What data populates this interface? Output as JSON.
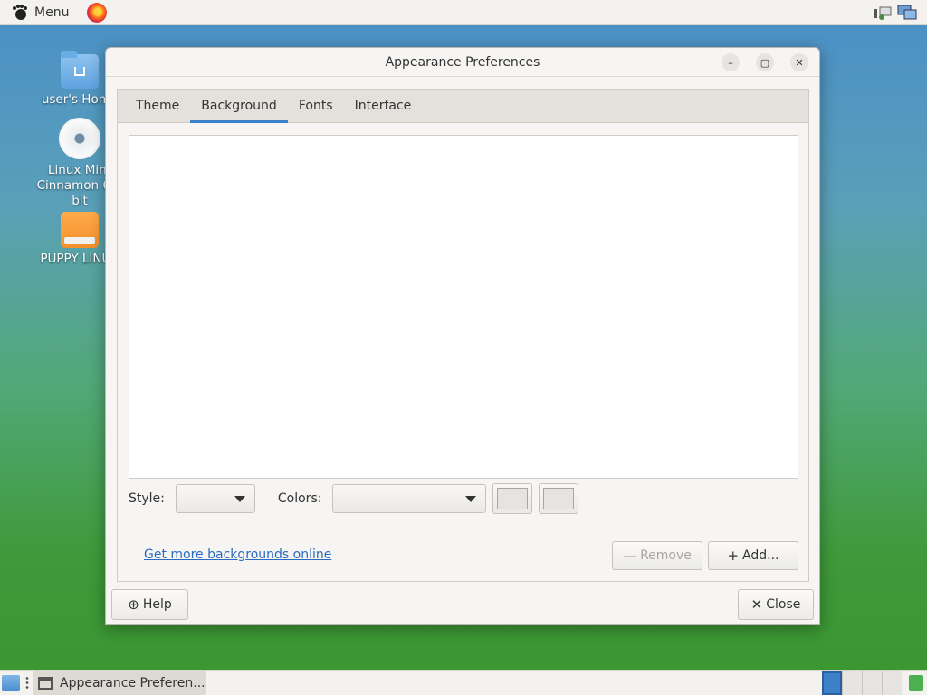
{
  "top_panel": {
    "menu_label": "Menu",
    "launchers": [
      "gnome-foot-icon",
      "firefox-icon"
    ],
    "tray_icons": [
      "network-icon",
      "display-icon"
    ]
  },
  "desktop": {
    "icons": [
      {
        "label": "user's Home",
        "icon": "home-folder-icon"
      },
      {
        "label": "Linux Mint Cinnamon 64-bit",
        "icon": "disc-icon"
      },
      {
        "label": "PUPPY LINUX",
        "icon": "drive-icon"
      }
    ]
  },
  "dialog": {
    "title": "Appearance Preferences",
    "tabs": [
      {
        "label": "Theme",
        "active": false
      },
      {
        "label": "Background",
        "active": true
      },
      {
        "label": "Fonts",
        "active": false
      },
      {
        "label": "Interface",
        "active": false
      }
    ],
    "style_label": "Style:",
    "style_value": "",
    "colors_label": "Colors:",
    "colors_value": "",
    "link_text": "Get more backgrounds online",
    "remove_label": "Remove",
    "add_label": "Add...",
    "help_label": "Help",
    "close_label": "Close"
  },
  "taskbar": {
    "task_label": "Appearance Preferen...",
    "workspaces": 4,
    "active_workspace": 1
  },
  "colors": {
    "accent": "#3b80c8",
    "link": "#2a6bc0"
  }
}
